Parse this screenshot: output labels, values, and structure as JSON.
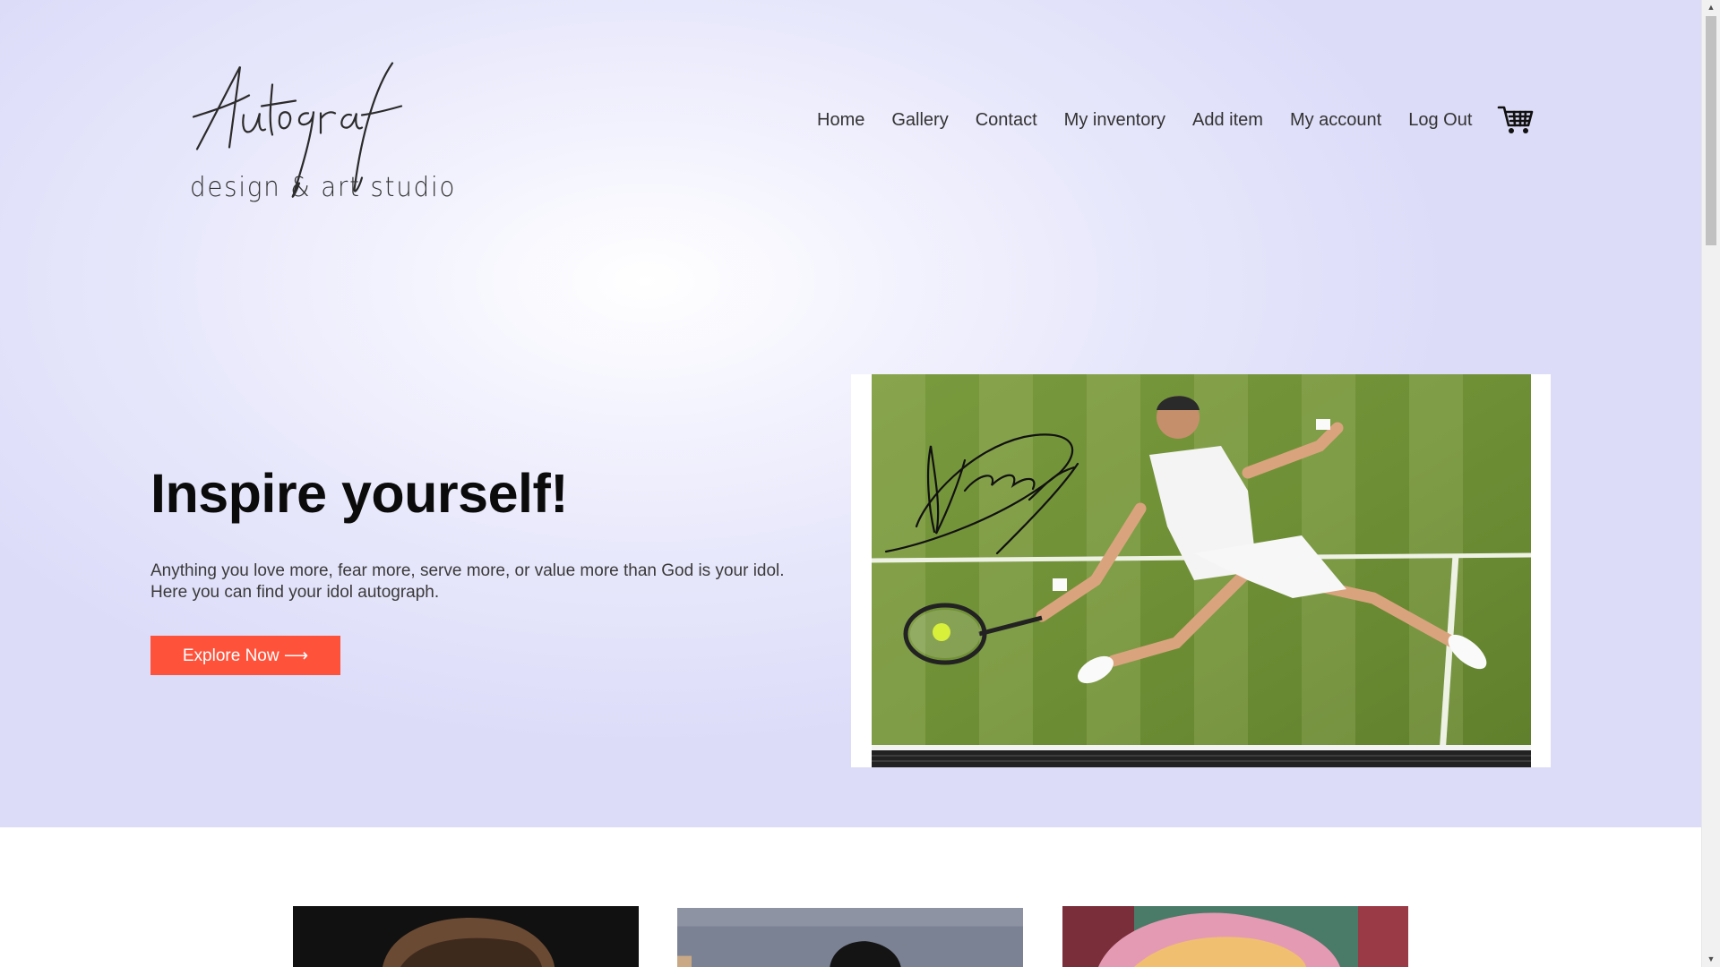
{
  "brand": {
    "logo_script": "Autograf",
    "logo_subtitle": "design & art studio"
  },
  "nav": {
    "items": [
      {
        "label": "Home"
      },
      {
        "label": "Gallery"
      },
      {
        "label": "Contact"
      },
      {
        "label": "My inventory"
      },
      {
        "label": "Add item"
      },
      {
        "label": "My account"
      },
      {
        "label": "Log Out"
      }
    ],
    "cart_icon": "shopping-cart-icon"
  },
  "hero": {
    "headline": "Inspire yourself!",
    "description_line1": "Anything you love more, fear more, serve more, or value more than God is your idol.",
    "description_line2": "Here you can find your idol autograph.",
    "cta_label": "Explore Now ⟶",
    "image_alt": "autographed tennis player photo"
  },
  "colors": {
    "accent": "#ff523b",
    "hero_bg": "#dcdcf9"
  },
  "products": [
    {
      "image": "portrait-1"
    },
    {
      "image": "portrait-2"
    },
    {
      "image": "portrait-3"
    }
  ]
}
